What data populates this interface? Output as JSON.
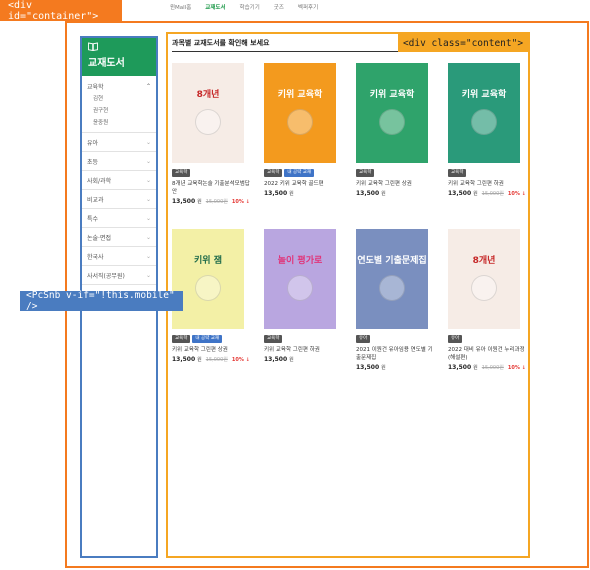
{
  "annotations": {
    "container": "<div id=\"container\">",
    "content": "<div class=\"content\">",
    "snb": "<PcSnb v-if=\"!this.mobile\" />"
  },
  "topnav": {
    "items": [
      "윈Mall홈",
      "교재도서",
      "학습기기",
      "굿즈",
      "벡퍼후기"
    ],
    "active_index": 1
  },
  "sidebar": {
    "title": "교재도서",
    "open_category": {
      "label": "교육학",
      "subs": [
        "김현",
        "권구현",
        "윤중원"
      ]
    },
    "categories": [
      "유아",
      "초등",
      "사회/과학",
      "비교과",
      "특수",
      "논술·면접",
      "한국사",
      "사서직(공무원)"
    ]
  },
  "content": {
    "heading": "과목별 교재도서를 확인해 보세요"
  },
  "books": [
    {
      "tags": [
        "교육학"
      ],
      "tag_colors": [
        "gray"
      ],
      "name": "8개년 교육학논술 기출분석모범답안",
      "price": "13,500",
      "won": "원",
      "orig": "15,000원",
      "disc": "10% ↓",
      "cover": {
        "bg": "#f6ece6",
        "fg": "#c62828",
        "text": "8개년"
      }
    },
    {
      "tags": [
        "교육학",
        "내 공략 교재"
      ],
      "tag_colors": [
        "gray",
        "blue"
      ],
      "name": "2022 키위 교육학 골드편",
      "price": "13,500",
      "won": "원",
      "orig": "",
      "disc": "",
      "cover": {
        "bg": "#f39a1e",
        "fg": "#ffffff",
        "text": "키위 교육학"
      }
    },
    {
      "tags": [
        "교육학"
      ],
      "tag_colors": [
        "gray"
      ],
      "name": "키위 교육학 그린편 상권",
      "price": "13,500",
      "won": "원",
      "orig": "",
      "disc": "",
      "cover": {
        "bg": "#2fa36b",
        "fg": "#ffffff",
        "text": "키위 교육학"
      }
    },
    {
      "tags": [
        "교육학"
      ],
      "tag_colors": [
        "gray"
      ],
      "name": "키위 교육학 그린편 하권",
      "price": "13,500",
      "won": "원",
      "orig": "15,000원",
      "disc": "10% ↓",
      "cover": {
        "bg": "#2a9a7a",
        "fg": "#ffffff",
        "text": "키위 교육학"
      }
    },
    {
      "tags": [
        "교육학",
        "내 공략 교재"
      ],
      "tag_colors": [
        "gray",
        "blue"
      ],
      "name": "키위 교육학 그린편 상권",
      "price": "13,500",
      "won": "원",
      "orig": "15,000원",
      "disc": "10% ↓",
      "cover": {
        "bg": "#f3f0a6",
        "fg": "#1f6b4a",
        "text": "키위 잼"
      }
    },
    {
      "tags": [
        "교육학"
      ],
      "tag_colors": [
        "gray"
      ],
      "name": "키위 교육학 그린편 하권",
      "price": "13,500",
      "won": "원",
      "orig": "",
      "disc": "",
      "cover": {
        "bg": "#b9a6e0",
        "fg": "#e0357a",
        "text": "놀이 평가로"
      }
    },
    {
      "tags": [
        "유아"
      ],
      "tag_colors": [
        "gray"
      ],
      "name": "2021 이원건 유아임용 연도별 기출문제집",
      "price": "13,500",
      "won": "원",
      "orig": "",
      "disc": "",
      "cover": {
        "bg": "#7a8fbf",
        "fg": "#ffffff",
        "text": "연도별 기출문제집"
      }
    },
    {
      "tags": [
        "유아"
      ],
      "tag_colors": [
        "gray"
      ],
      "name": "2022 대비 유아 이원건 누리과정 (해설편)",
      "price": "13,500",
      "won": "원",
      "orig": "15,000원",
      "disc": "10% ↓",
      "cover": {
        "bg": "#f6ece6",
        "fg": "#c62828",
        "text": "8개년"
      }
    }
  ]
}
